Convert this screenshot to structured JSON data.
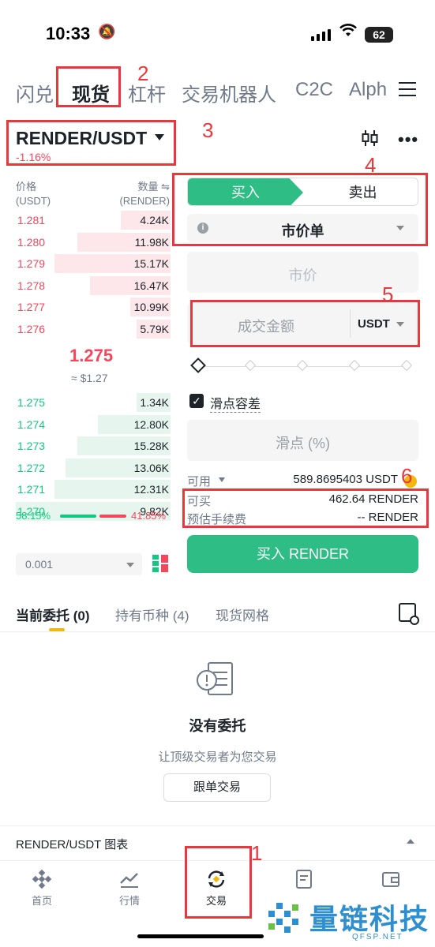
{
  "status": {
    "time": "10:33",
    "battery": "62"
  },
  "top_nav": {
    "tabs": [
      "闪兑",
      "现货",
      "杠杆",
      "交易机器人",
      "C2C",
      "Alph"
    ],
    "active": "现货"
  },
  "annotations": [
    "1",
    "2",
    "3",
    "4",
    "5",
    "6"
  ],
  "pair": {
    "name": "RENDER/USDT",
    "change": "-1.16%"
  },
  "orderbook": {
    "price_header": "价格",
    "price_unit": "(USDT)",
    "qty_header": "数量 ⇋",
    "qty_unit": "(RENDER)",
    "asks": [
      {
        "price": "1.281",
        "qty": "4.24K",
        "depth": 0.32
      },
      {
        "price": "1.280",
        "qty": "11.98K",
        "depth": 0.6
      },
      {
        "price": "1.279",
        "qty": "15.17K",
        "depth": 0.75
      },
      {
        "price": "1.278",
        "qty": "16.47K",
        "depth": 0.52
      },
      {
        "price": "1.277",
        "qty": "10.99K",
        "depth": 0.26
      },
      {
        "price": "1.276",
        "qty": "5.79K",
        "depth": 0.22
      }
    ],
    "mid_price": "1.275",
    "mid_usd": "≈ $1.27",
    "bids": [
      {
        "price": "1.275",
        "qty": "1.34K",
        "depth": 0.22
      },
      {
        "price": "1.274",
        "qty": "12.80K",
        "depth": 0.47
      },
      {
        "price": "1.273",
        "qty": "15.28K",
        "depth": 0.6
      },
      {
        "price": "1.272",
        "qty": "13.06K",
        "depth": 0.68
      },
      {
        "price": "1.271",
        "qty": "12.31K",
        "depth": 0.75
      },
      {
        "price": "1.270",
        "qty": "9.82K",
        "depth": 1.0
      }
    ],
    "buy_ratio": "58.15%",
    "sell_ratio": "41.85%",
    "precision": "0.001"
  },
  "order_form": {
    "buy_label": "买入",
    "sell_label": "卖出",
    "order_type": "市价单",
    "market_placeholder": "市价",
    "amount_placeholder": "成交金额",
    "amount_unit": "USDT",
    "slippage_checkbox": "滑点容差",
    "slippage_placeholder": "滑点 (%)",
    "available_label": "可用",
    "available_value": "589.8695403 USDT",
    "can_buy_label": "可买",
    "can_buy_value": "462.64 RENDER",
    "fee_label": "预估手续费",
    "fee_value": "-- RENDER",
    "buy_button": "买入 RENDER"
  },
  "order_tabs": [
    "当前委托 (0)",
    "持有币种 (4)",
    "现货网格"
  ],
  "empty_state": {
    "title": "没有委托",
    "subtitle": "让顶级交易者为您交易",
    "button": "跟单交易"
  },
  "chart_section": {
    "label": "RENDER/USDT 图表"
  },
  "bottom_tabs": [
    {
      "label": "首页",
      "icon": "home-diamond-icon"
    },
    {
      "label": "行情",
      "icon": "market-chart-icon"
    },
    {
      "label": "交易",
      "icon": "trade-exchange-icon"
    },
    {
      "label": "",
      "icon": "futures-doc-icon"
    },
    {
      "label": "",
      "icon": "wallet-icon"
    }
  ],
  "watermark": {
    "text": "量链科技",
    "sub": "QFSP.NET"
  },
  "colors": {
    "green": "#2ebd85",
    "red": "#f6465d",
    "annotation": "#e8383d",
    "accent": "#f0b90b"
  }
}
